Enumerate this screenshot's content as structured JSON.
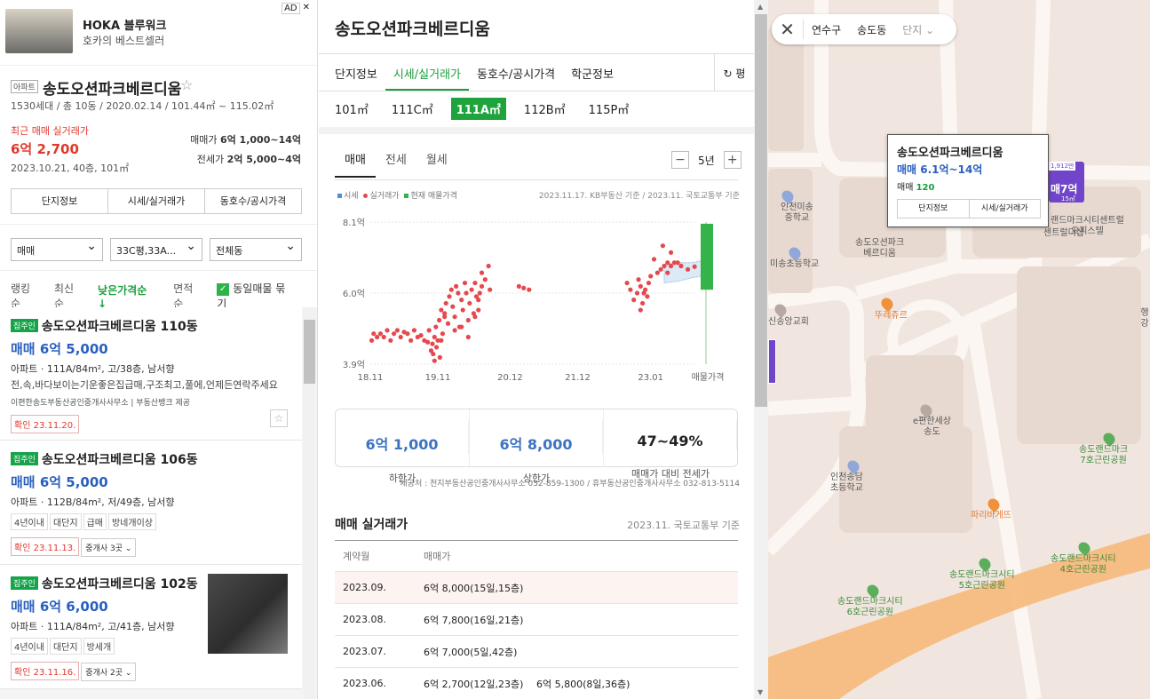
{
  "ad": {
    "title": "HOKA 블루워크",
    "subtitle": "호카의 베스트셀러",
    "tag": "AD",
    "close": "✕"
  },
  "summary": {
    "type_badge": "아파트",
    "name": "송도오션파크베르디움",
    "star": "☆",
    "info": "1530세대 / 총 10동 / 2020.02.14 / 101.44㎡ ~ 115.02㎡",
    "recent_label": "최근 매매 실거래가",
    "recent_price": "6억 2,700",
    "recent_date": "2023.10.21, 40층, 101㎡",
    "sale_label": "매매가",
    "sale_range": "6억 1,000~14억",
    "jeonse_label": "전세가",
    "jeonse_range": "2억 5,000~4억",
    "buttons": [
      "단지정보",
      "시세/실거래가",
      "동호수/공시가격"
    ]
  },
  "filters": {
    "deal": "매매",
    "size": "33C평,33A...",
    "dong": "전체동"
  },
  "sorts": {
    "items": [
      "랭킹순",
      "최신순",
      "낮은가격순 ↓",
      "면적순"
    ],
    "active": "낮은가격순 ↓",
    "group_label": "동일매물 묶기",
    "group_check": "✓"
  },
  "listings": [
    {
      "tag": "집주인",
      "name": "송도오션파크베르디움 110동",
      "price": "매매 6억 5,000",
      "detail": "아파트 · 111A/84m², 고/38층, 남서향",
      "desc": "전,속,바다보이는기운좋은집급매,구조최고,풀에,언제든연락주세요",
      "agent": "이편한송도부동산공인중개사사무소 | 부동산뱅크 제공",
      "confirm": "확인 23.11.20."
    },
    {
      "tag": "집주인",
      "name": "송도오션파크베르디움 106동",
      "price": "매매 6억 5,000",
      "detail": "아파트 · 112B/84m², 저/49층, 남서향",
      "chips": [
        "4년이내",
        "대단지",
        "급매",
        "방네개이상"
      ],
      "confirm": "확인 23.11.13.",
      "brokers": "중개사 3곳 ⌄"
    },
    {
      "tag": "집주인",
      "name": "송도오션파크베르디움 102동",
      "price": "매매 6억 6,000",
      "detail": "아파트 · 111A/84m², 고/41층, 남서향",
      "chips": [
        "4년이내",
        "대단지",
        "방세개"
      ],
      "confirm": "확인 23.11.16.",
      "brokers": "중개사 2곳 ⌄"
    }
  ],
  "detail": {
    "title": "송도오션파크베르디움",
    "tabs": [
      "단지정보",
      "시세/실거래가",
      "동호수/공시가격",
      "학군정보"
    ],
    "active_tab": "시세/실거래가",
    "unit_toggle": "↻ 평",
    "sizes": [
      "101㎡",
      "111C㎡",
      "111A㎡",
      "112B㎡",
      "115P㎡"
    ],
    "active_size": "111A㎡",
    "chart_tabs": [
      "매매",
      "전세",
      "월세"
    ],
    "active_chart_tab": "매매",
    "period": "5년",
    "minus": "−",
    "plus": "+",
    "legend": [
      "시세",
      "실거래가",
      "현재 매물가격"
    ],
    "basis": "2023.11.17. KB부동산 기준 / 2023.11. 국토교통부 기준",
    "stats": [
      {
        "value": "6억 1,000",
        "label": "하한가"
      },
      {
        "value": "6억 8,000",
        "label": "상한가"
      },
      {
        "value": "47~49%",
        "label": "매매가 대비 전세가"
      }
    ],
    "provider": "제공처 : 천지부동산공인중개사사무소 032-859-1300 / 휴부동산공인중개사사무소 032-813-5114",
    "trades_title": "매매 실거래가",
    "trades_basis": "2023.11. 국토교통부 기준",
    "trades_header": [
      "계약월",
      "매매가"
    ],
    "trades": [
      {
        "month": "2023.09.",
        "deals": [
          "6억 8,000(15일,15층)"
        ]
      },
      {
        "month": "2023.08.",
        "deals": [
          "6억 7,800(16일,21층)"
        ]
      },
      {
        "month": "2023.07.",
        "deals": [
          "6억 7,000(5일,42층)"
        ]
      },
      {
        "month": "2023.06.",
        "deals": [
          "6억 2,700(12일,23층)",
          "6억 5,800(8일,36층)"
        ]
      }
    ]
  },
  "chart_data": {
    "type": "scatter",
    "ytick_labels": [
      "8.1억",
      "6.0억",
      "3.9억"
    ],
    "yticks": [
      8.1,
      6.0,
      3.9
    ],
    "ylim": [
      3.9,
      8.1
    ],
    "xtick_labels": [
      "18.11",
      "19.11",
      "20.12",
      "21.12",
      "23.01",
      "매물가격"
    ],
    "xticks": [
      2018.85,
      2019.85,
      2020.92,
      2021.92,
      2023.0
    ],
    "xlim": [
      2018.85,
      2023.95
    ],
    "series": [
      {
        "name": "실거래가",
        "color": "#e5484d",
        "points": [
          [
            2018.87,
            4.6
          ],
          [
            2018.9,
            4.8
          ],
          [
            2018.95,
            4.7
          ],
          [
            2019.0,
            4.8
          ],
          [
            2019.05,
            4.7
          ],
          [
            2019.1,
            4.9
          ],
          [
            2019.15,
            4.6
          ],
          [
            2019.2,
            4.8
          ],
          [
            2019.25,
            4.9
          ],
          [
            2019.3,
            4.7
          ],
          [
            2019.35,
            4.85
          ],
          [
            2019.4,
            4.8
          ],
          [
            2019.45,
            4.6
          ],
          [
            2019.5,
            4.9
          ],
          [
            2019.55,
            4.7
          ],
          [
            2019.6,
            4.75
          ],
          [
            2019.65,
            4.6
          ],
          [
            2019.7,
            4.55
          ],
          [
            2019.72,
            4.9
          ],
          [
            2019.75,
            4.3
          ],
          [
            2019.77,
            4.5
          ],
          [
            2019.8,
            4.7
          ],
          [
            2019.82,
            5.0
          ],
          [
            2019.85,
            4.6
          ],
          [
            2019.87,
            5.2
          ],
          [
            2019.9,
            5.5
          ],
          [
            2019.92,
            4.8
          ],
          [
            2019.95,
            5.4
          ],
          [
            2019.97,
            5.7
          ],
          [
            2020.0,
            5.1
          ],
          [
            2020.02,
            5.9
          ],
          [
            2020.05,
            6.1
          ],
          [
            2020.07,
            5.6
          ],
          [
            2020.1,
            5.3
          ],
          [
            2020.12,
            6.2
          ],
          [
            2020.15,
            6.0
          ],
          [
            2020.17,
            5.0
          ],
          [
            2020.2,
            5.8
          ],
          [
            2020.22,
            5.5
          ],
          [
            2020.25,
            6.3
          ],
          [
            2020.27,
            6.0
          ],
          [
            2020.3,
            5.2
          ],
          [
            2020.32,
            5.7
          ],
          [
            2020.35,
            6.1
          ],
          [
            2020.38,
            5.4
          ],
          [
            2020.4,
            6.3
          ],
          [
            2020.42,
            5.9
          ],
          [
            2020.45,
            5.5
          ],
          [
            2020.47,
            6.0
          ],
          [
            2020.5,
            6.6
          ],
          [
            2020.55,
            6.4
          ],
          [
            2020.6,
            6.8
          ],
          [
            2020.62,
            6.1
          ],
          [
            2019.78,
            4.2
          ],
          [
            2019.8,
            4.0
          ],
          [
            2019.83,
            4.4
          ],
          [
            2019.88,
            4.1
          ],
          [
            2019.9,
            4.6
          ],
          [
            2019.95,
            5.3
          ],
          [
            2020.1,
            4.9
          ],
          [
            2020.2,
            5.0
          ],
          [
            2020.3,
            4.7
          ],
          [
            2020.4,
            5.3
          ],
          [
            2020.45,
            5.8
          ],
          [
            2020.5,
            6.2
          ],
          [
            2021.05,
            6.2
          ],
          [
            2021.12,
            6.15
          ],
          [
            2021.2,
            6.1
          ],
          [
            2022.65,
            6.3
          ],
          [
            2022.7,
            6.1
          ],
          [
            2022.75,
            5.8
          ],
          [
            2022.8,
            6.0
          ],
          [
            2022.82,
            6.4
          ],
          [
            2022.85,
            6.2
          ],
          [
            2022.88,
            5.7
          ],
          [
            2022.9,
            6.0
          ],
          [
            2022.92,
            6.1
          ],
          [
            2022.95,
            5.9
          ],
          [
            2022.97,
            6.3
          ],
          [
            2022.85,
            5.5
          ],
          [
            2023.0,
            6.5
          ],
          [
            2023.05,
            7.0
          ],
          [
            2023.1,
            6.6
          ],
          [
            2023.15,
            6.7
          ],
          [
            2023.2,
            6.8
          ],
          [
            2023.25,
            6.9
          ],
          [
            2023.3,
            6.8
          ],
          [
            2023.35,
            6.9
          ],
          [
            2023.4,
            6.9
          ],
          [
            2023.45,
            6.8
          ],
          [
            2023.55,
            6.7
          ],
          [
            2023.65,
            6.78
          ],
          [
            2023.18,
            7.4
          ],
          [
            2023.25,
            6.6
          ],
          [
            2023.3,
            7.2
          ]
        ]
      },
      {
        "name": "시세",
        "color": "#4a90d9",
        "upper": [
          [
            2023.2,
            6.85
          ],
          [
            2023.4,
            6.9
          ],
          [
            2023.6,
            6.9
          ],
          [
            2023.75,
            6.95
          ]
        ],
        "lower": [
          [
            2023.2,
            6.3
          ],
          [
            2023.4,
            6.35
          ],
          [
            2023.6,
            6.45
          ],
          [
            2023.75,
            6.5
          ]
        ]
      },
      {
        "name": "현재 매물가격",
        "color": "#34b34a",
        "range": [
          6.1,
          14.0
        ]
      }
    ]
  },
  "map": {
    "crumbs": [
      "연수구",
      "송도동",
      "단지 ⌄"
    ],
    "close": "✕",
    "popup": {
      "name": "송도오션파크베르디움",
      "price": "매매 6.1억~14억",
      "count_label": "매매",
      "count": "120",
      "buttons": [
        "단지정보",
        "시세/실거래가"
      ]
    },
    "pin": {
      "top": "1,912만",
      "price": "매7억",
      "sub": "15㎡"
    },
    "labels": [
      {
        "t": "인천미송\n중학교"
      },
      {
        "t": "미송초등학교"
      },
      {
        "t": "송도오션파크\n베르디움"
      },
      {
        "t": "뚜레쥬르"
      },
      {
        "t": "신송앙교회"
      },
      {
        "t": "e편한세상\n송도"
      },
      {
        "t": "인천송담\n초등학교"
      },
      {
        "t": "파리바게뜨"
      },
      {
        "t": "송도랜드마크시티\n6호근린공원"
      },
      {
        "t": "송도랜드마크시티\n5호근린공원"
      },
      {
        "t": "송도랜드마크시티\n4호근린공원"
      },
      {
        "t": "송도랜드마크\n7호근린공원"
      },
      {
        "t": "랜드마크시티센트럴\n오피스텔"
      },
      {
        "t": "센트럴더샵"
      },
      {
        "t": "행강"
      }
    ]
  }
}
